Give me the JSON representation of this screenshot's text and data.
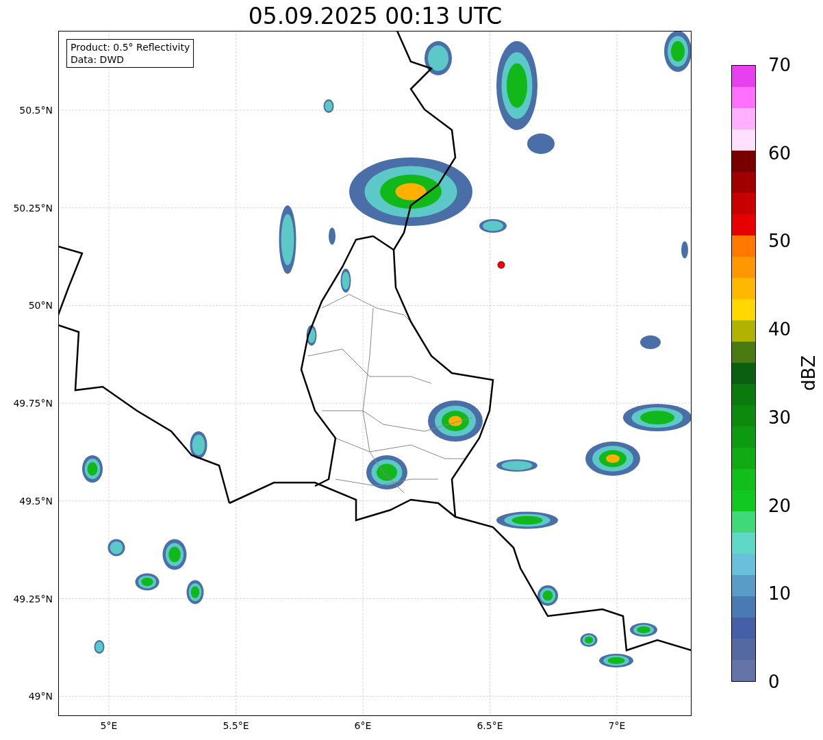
{
  "title": "05.09.2025 00:13 UTC",
  "info_box": [
    "Product: 0.5° Reflectivity",
    "Data: DWD"
  ],
  "y_ticks": [
    "50.5°N",
    "50.25°N",
    "50°N",
    "49.75°N",
    "49.5°N",
    "49.25°N",
    "49°N"
  ],
  "x_ticks": [
    "5°E",
    "5.5°E",
    "6°E",
    "6.5°E",
    "7°E"
  ],
  "colorbar": {
    "label": "dBZ",
    "ticks": [
      "70",
      "60",
      "50",
      "40",
      "30",
      "20",
      "10",
      "0"
    ],
    "bands": [
      {
        "color": "#e840f0"
      },
      {
        "color": "#ff70ff"
      },
      {
        "color": "#ffb0ff"
      },
      {
        "color": "#ffe0ff"
      },
      {
        "color": "#780000"
      },
      {
        "color": "#a00000"
      },
      {
        "color": "#c80000"
      },
      {
        "color": "#e80000"
      },
      {
        "color": "#ff7800"
      },
      {
        "color": "#ff9800"
      },
      {
        "color": "#ffb800"
      },
      {
        "color": "#ffd800"
      },
      {
        "color": "#b0b400"
      },
      {
        "color": "#4a7a10"
      },
      {
        "color": "#0a6010"
      },
      {
        "color": "#0a7a0c"
      },
      {
        "color": "#0c8a0e"
      },
      {
        "color": "#0e9a10"
      },
      {
        "color": "#10aa12"
      },
      {
        "color": "#12be1a"
      },
      {
        "color": "#10c820"
      },
      {
        "color": "#40d878"
      },
      {
        "color": "#60d8c8"
      },
      {
        "color": "#68c0dc"
      },
      {
        "color": "#5a9cc8"
      },
      {
        "color": "#4a7ab4"
      },
      {
        "color": "#4560a6"
      },
      {
        "color": "#5668a0"
      },
      {
        "color": "#6574a8"
      }
    ]
  }
}
